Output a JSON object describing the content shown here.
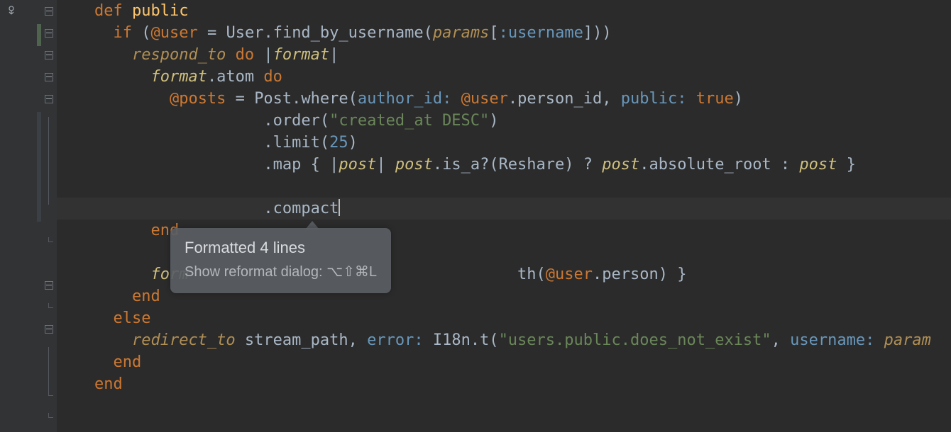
{
  "tooltip": {
    "line1": "Formatted 4 lines",
    "line2": "Show reformat dialog: ⌥⇧⌘L"
  },
  "code": {
    "l1": {
      "a": "def ",
      "b": "public"
    },
    "l2": {
      "a": "if ",
      "b": "(",
      "c": "@user",
      "d": " = ",
      "e": "User",
      "f": ".find_by_username(",
      "g": "params",
      "h": "[",
      "i": ":username",
      "j": "]))"
    },
    "l3": {
      "a": "respond_to ",
      "b": "do ",
      "c": "|",
      "d": "format",
      "e": "|"
    },
    "l4": {
      "a": "format",
      "b": ".atom ",
      "c": "do"
    },
    "l5": {
      "a": "@posts",
      "b": " = ",
      "c": "Post",
      "d": ".where(",
      "e": "author_id: ",
      "f": "@user",
      "g": ".person_id, ",
      "h": "public: ",
      "i": "true",
      "j": ")"
    },
    "l6": {
      "a": ".order(",
      "b": "\"created_at DESC\"",
      "c": ")"
    },
    "l7": {
      "a": ".limit(",
      "b": "25",
      "c": ")"
    },
    "l8": {
      "a": ".map { |",
      "b": "post",
      "c": "| ",
      "d": "post",
      "e": ".is_a?(",
      "f": "Reshare",
      "g": ") ? ",
      "h": "post",
      "i": ".absolute_root : ",
      "j": "post",
      "k": " }"
    },
    "l9": {
      "a": ".compact"
    },
    "l10": {
      "a": "end"
    },
    "l12": {
      "a": "form",
      "b": "th(",
      "c": "@user",
      "d": ".person) }"
    },
    "l13": {
      "a": "end"
    },
    "l14": {
      "a": "else"
    },
    "l15": {
      "a": "redirect_to ",
      "b": "stream_path, ",
      "c": "error: ",
      "d": "I18n",
      "e": ".t(",
      "f": "\"users.public.does_not_exist\"",
      "g": ", ",
      "h": "username: ",
      "i": "param"
    },
    "l16": {
      "a": "end"
    },
    "l17": {
      "a": "end"
    }
  },
  "indent": {
    "i1": "    ",
    "i2": "      ",
    "i3": "        ",
    "i4": "          ",
    "i5": "            ",
    "i6": "                      "
  }
}
